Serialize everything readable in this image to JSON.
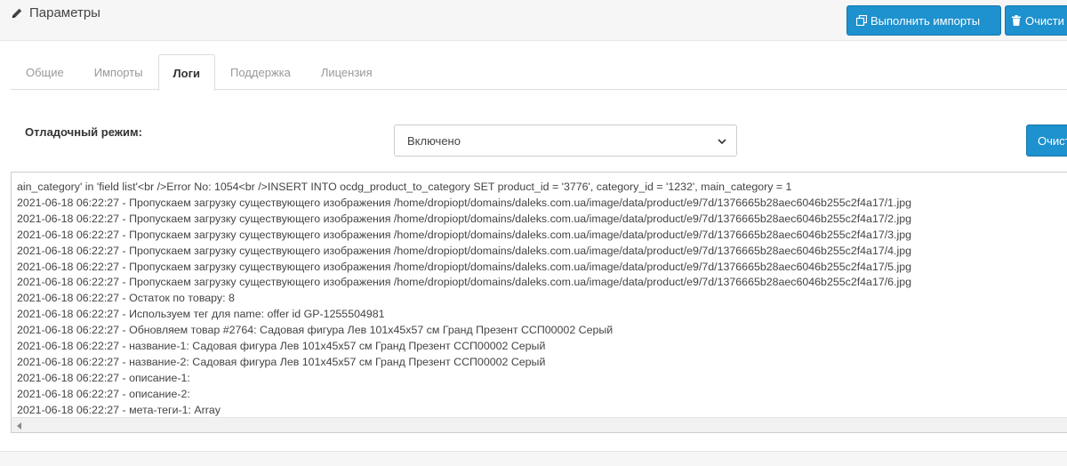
{
  "header": {
    "title": "Параметры",
    "title_icon": "pencil-icon",
    "run_import_label": "Выполнить импорты",
    "run_import_icon": "copy-icon",
    "clear_label": "Очисти",
    "clear_icon": "trash-icon"
  },
  "tabs": [
    {
      "label": "Общие",
      "active": false
    },
    {
      "label": "Импорты",
      "active": false
    },
    {
      "label": "Логи",
      "active": true
    },
    {
      "label": "Поддержка",
      "active": false
    },
    {
      "label": "Лицензия",
      "active": false
    }
  ],
  "debug": {
    "label": "Отладочный режим:",
    "select_value": "Включено",
    "clear_button_label": "Очистить"
  },
  "log": {
    "lines": [
      "ain_category' in 'field list'<br />Error No: 1054<br />INSERT INTO ocdg_product_to_category SET product_id = '3776', category_id = '1232', main_category = 1",
      "2021-06-18 06:22:27 - Пропускаем загрузку существующего изображения /home/dropiopt/domains/daleks.com.ua/image/data/product/e9/7d/1376665b28aec6046b255c2f4a17/1.jpg",
      "2021-06-18 06:22:27 - Пропускаем загрузку существующего изображения /home/dropiopt/domains/daleks.com.ua/image/data/product/e9/7d/1376665b28aec6046b255c2f4a17/2.jpg",
      "2021-06-18 06:22:27 - Пропускаем загрузку существующего изображения /home/dropiopt/domains/daleks.com.ua/image/data/product/e9/7d/1376665b28aec6046b255c2f4a17/3.jpg",
      "2021-06-18 06:22:27 - Пропускаем загрузку существующего изображения /home/dropiopt/domains/daleks.com.ua/image/data/product/e9/7d/1376665b28aec6046b255c2f4a17/4.jpg",
      "2021-06-18 06:22:27 - Пропускаем загрузку существующего изображения /home/dropiopt/domains/daleks.com.ua/image/data/product/e9/7d/1376665b28aec6046b255c2f4a17/5.jpg",
      "2021-06-18 06:22:27 - Пропускаем загрузку существующего изображения /home/dropiopt/domains/daleks.com.ua/image/data/product/e9/7d/1376665b28aec6046b255c2f4a17/6.jpg",
      "2021-06-18 06:22:27 - Остаток по товару: 8",
      "2021-06-18 06:22:27 - Используем тег для name: offer id GP-1255504981",
      "2021-06-18 06:22:27 - Обновляем товар #2764: Садовая фигура Лев 101х45х57 см Гранд Презент ССП00002 Серый",
      "2021-06-18 06:22:27 - название-1: Садовая фигура Лев 101х45х57 см Гранд Презент ССП00002 Серый",
      "2021-06-18 06:22:27 - название-2: Садовая фигура Лев 101х45х57 см Гранд Презент ССП00002 Серый",
      "2021-06-18 06:22:27 - описание-1:",
      "2021-06-18 06:22:27 - описание-2:",
      "2021-06-18 06:22:27 - мета-теги-1: Array"
    ]
  },
  "colors": {
    "primary": "#1e91cf",
    "header_bg": "#f6f6f6"
  }
}
